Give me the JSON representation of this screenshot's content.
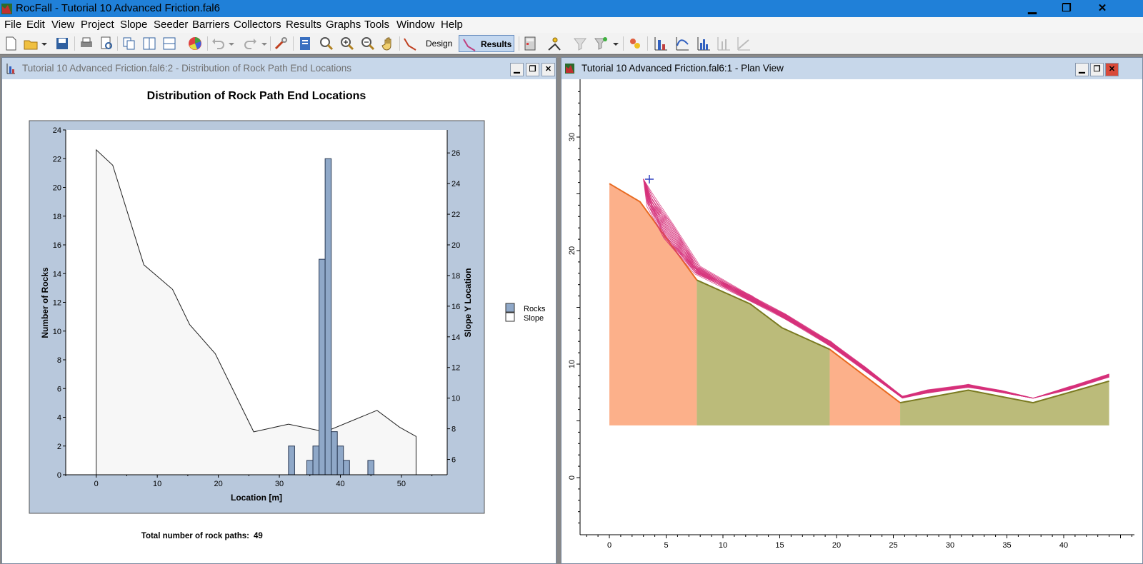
{
  "window": {
    "title": "RocFall - Tutorial 10 Advanced Friction.fal6",
    "minimize_label": "▁",
    "restore_label": "❐",
    "close_label": "✕"
  },
  "menu": [
    "File",
    "Edit",
    "View",
    "Project",
    "Slope",
    "Seeder",
    "Barriers",
    "Collectors",
    "Results",
    "Graphs",
    "Tools",
    "Window",
    "Help"
  ],
  "toolbar": {
    "design_label": "Design",
    "results_label": "Results",
    "icons": [
      "new-file-icon",
      "open-folder-icon",
      "save-icon",
      "print-icon",
      "print-preview-icon",
      "copy-icon",
      "tile-vertical-icon",
      "tile-horizontal-icon",
      "color-wheel-icon",
      "undo-icon",
      "redo-icon",
      "wrench-icon",
      "document-info-icon",
      "zoom-all-icon",
      "zoom-in-icon",
      "zoom-out-icon",
      "pan-hand-icon",
      "calculator-icon",
      "seeder-icon",
      "filter-icon",
      "filter-dropdown-icon",
      "rocks-icon",
      "graph-icons"
    ]
  },
  "left_window": {
    "title": "Tutorial 10 Advanced Friction.fal6:2 - Distribution of Rock Path End Locations",
    "total_label": "Total number of rock paths:",
    "total_value": "49"
  },
  "right_window": {
    "title": "Tutorial 10 Advanced Friction.fal6:1 - Plan View",
    "x_ticks": [
      "0",
      "5",
      "10",
      "15",
      "20",
      "25",
      "30",
      "35",
      "40"
    ],
    "y_ticks": [
      "0",
      "10",
      "20",
      "30"
    ]
  },
  "chart_data": {
    "type": "bar",
    "title": "Distribution of Rock Path End Locations",
    "xlabel": "Location [m]",
    "ylabel": "Number of Rocks",
    "y2label": "Slope Y Location",
    "xlim": [
      -5,
      57.5
    ],
    "ylim": [
      0,
      24
    ],
    "y2lim": [
      5,
      27.5
    ],
    "x_ticks": [
      0,
      10,
      20,
      30,
      40,
      50
    ],
    "y_ticks": [
      0,
      2,
      4,
      6,
      8,
      10,
      12,
      14,
      16,
      18,
      20,
      22,
      24
    ],
    "y2_ticks": [
      6,
      8,
      10,
      12,
      14,
      16,
      18,
      20,
      22,
      24,
      26
    ],
    "legend": [
      {
        "name": "Rocks",
        "color": "#8fa8c8"
      },
      {
        "name": "Slope",
        "color": "#ffffff"
      }
    ],
    "legend_position": "right",
    "bin_width": 1,
    "bins": [
      {
        "x": 32,
        "value": 2
      },
      {
        "x": 35,
        "value": 1
      },
      {
        "x": 36,
        "value": 2
      },
      {
        "x": 37,
        "value": 15
      },
      {
        "x": 38,
        "value": 22
      },
      {
        "x": 39,
        "value": 3
      },
      {
        "x": 40,
        "value": 2
      },
      {
        "x": 41,
        "value": 1
      },
      {
        "x": 45,
        "value": 1
      }
    ],
    "slope": {
      "x": [
        0,
        2.7,
        7.8,
        12.5,
        15.3,
        19.5,
        25.8,
        31.5,
        37.5,
        46,
        49.7,
        52.4
      ],
      "y": [
        26.2,
        25.2,
        18.7,
        17.1,
        14.8,
        12.9,
        7.8,
        8.3,
        7.8,
        9.2,
        8.1,
        7.5
      ]
    }
  },
  "plan_view": {
    "colors": {
      "orange_material": "#fcb08a",
      "olive_material": "#bbbb7a",
      "path_color": "#d6307a",
      "slope_edge_orange": "#e86a20",
      "slope_edge_olive": "#7a7a20"
    }
  }
}
